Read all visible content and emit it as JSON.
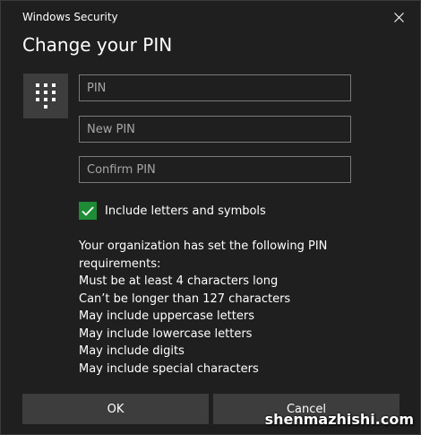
{
  "window": {
    "title": "Windows Security",
    "close_glyph": "✕"
  },
  "dialog": {
    "heading": "Change your PIN"
  },
  "keypad": {
    "icon": "keypad-icon"
  },
  "fields": {
    "pin": {
      "placeholder": "PIN",
      "value": ""
    },
    "new_pin": {
      "placeholder": "New PIN",
      "value": ""
    },
    "confirm_pin": {
      "placeholder": "Confirm PIN",
      "value": ""
    }
  },
  "options": {
    "include_letters_label": "Include letters and symbols",
    "include_letters_checked": true
  },
  "requirements": {
    "lines": [
      "Your organization has set the following PIN",
      "requirements:",
      "Must be at least 4 characters long",
      "Can’t be longer than 127 characters",
      "May include uppercase letters",
      "May include lowercase letters",
      "May include digits",
      "May include special characters"
    ]
  },
  "buttons": {
    "ok_label": "OK",
    "cancel_label": "Cancel"
  },
  "watermark": {
    "text": "shenmazhishi.com"
  },
  "colors": {
    "background": "#1f1f1f",
    "tile": "#3d3d3d",
    "field_border": "#7a7a7a",
    "checkbox": "#1e8c36",
    "text": "#ffffff",
    "placeholder": "#a6a6a6"
  }
}
